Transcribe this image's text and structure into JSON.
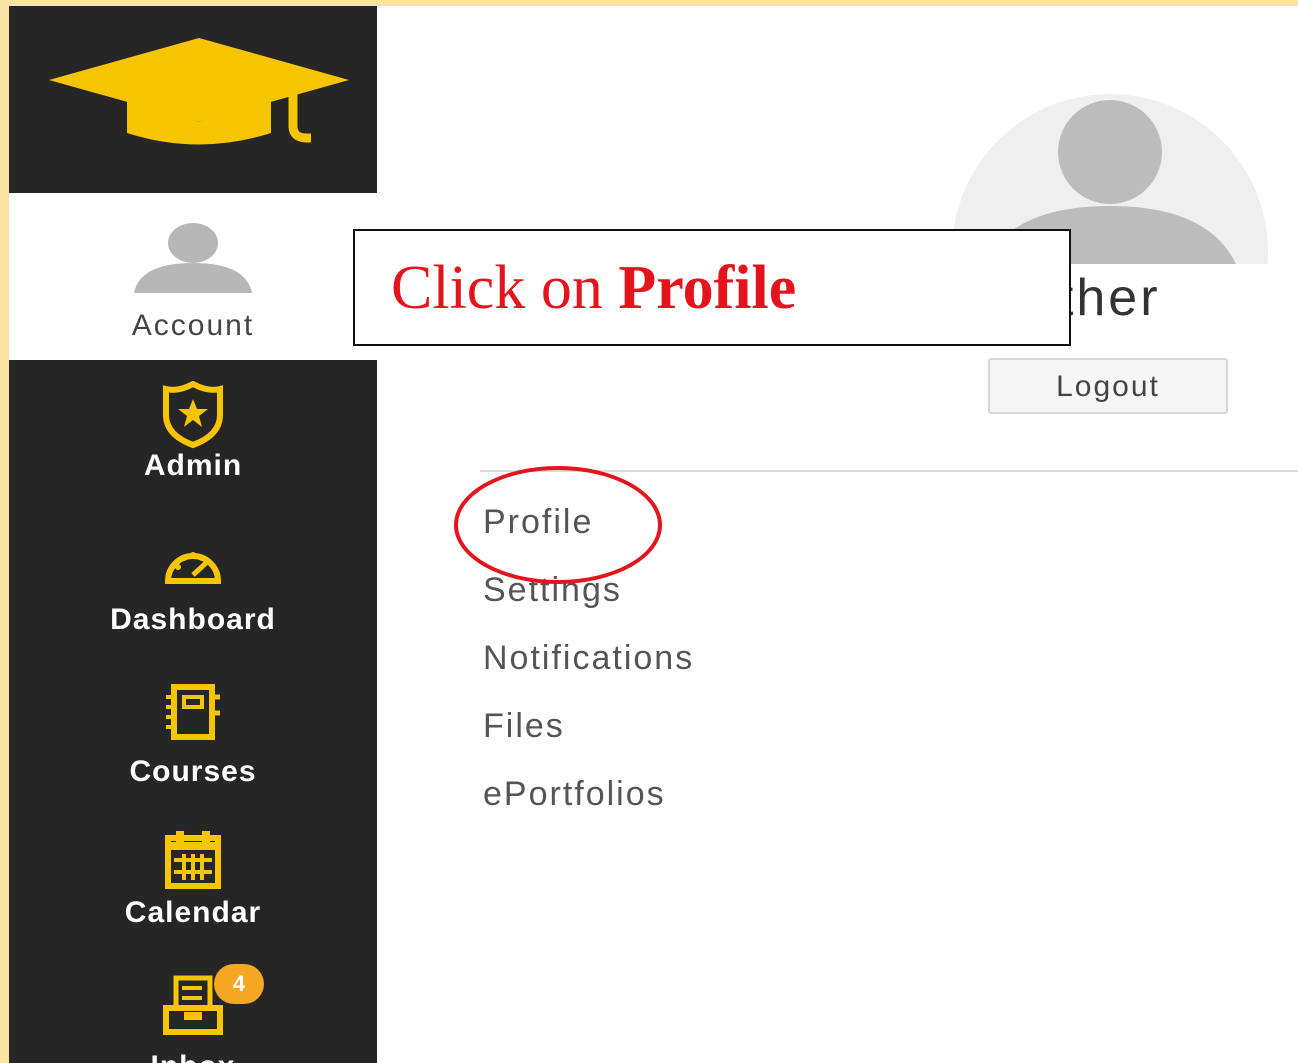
{
  "sidebar": {
    "logo_icon": "graduation-cap-icon",
    "account": {
      "label": "Account",
      "icon": "user-icon"
    },
    "items": [
      {
        "label": "Admin",
        "icon": "shield-star-icon"
      },
      {
        "label": "Dashboard",
        "icon": "speedometer-icon"
      },
      {
        "label": "Courses",
        "icon": "notebook-icon"
      },
      {
        "label": "Calendar",
        "icon": "calendar-icon"
      },
      {
        "label": "Inbox",
        "icon": "inbox-icon",
        "badge": "4"
      }
    ]
  },
  "tray": {
    "user_name_fragment": "uther",
    "logout_label": "Logout",
    "menu": [
      "Profile",
      "Settings",
      "Notifications",
      "Files",
      "ePortfolios"
    ]
  },
  "annotation": {
    "prefix": "Click on ",
    "bold": "Profile"
  },
  "colors": {
    "brand_yellow": "#f7c400",
    "sidebar_bg": "#262626",
    "annotation_red": "#e3141b",
    "badge": "#f5a623"
  }
}
